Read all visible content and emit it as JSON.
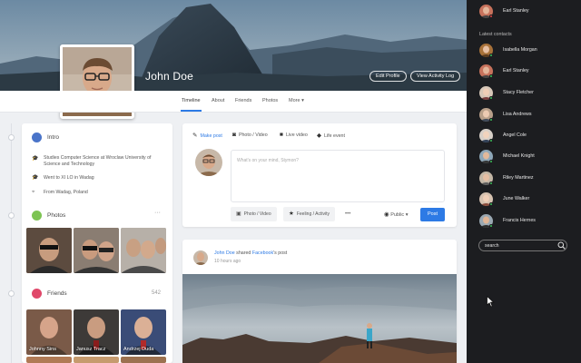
{
  "profile": {
    "name": "John Doe",
    "edit_profile": "Edit Profile",
    "view_activity": "View Activity Log"
  },
  "nav": {
    "tabs": [
      "Timeline",
      "About",
      "Friends",
      "Photos"
    ],
    "more": "More",
    "more_chevron": "▾"
  },
  "intro": {
    "title": "Intro",
    "items": [
      {
        "icon": "graduation-cap-icon",
        "text": "Studies Computer Science at Wroclaw University of Science and Technology"
      },
      {
        "icon": "graduation-cap-icon",
        "text": "Went to XI LO in Wadag"
      },
      {
        "icon": "location-pin-icon",
        "text": "From Wadag, Poland"
      }
    ]
  },
  "photos": {
    "title": "Photos",
    "more": "···"
  },
  "friends": {
    "title": "Friends",
    "count": "542",
    "list": [
      "Johnny Sins",
      "Janusz Tracz",
      "Andrzej Duda"
    ]
  },
  "composer": {
    "tabs": [
      {
        "icon": "pencil-icon",
        "label": "Make post"
      },
      {
        "icon": "camera-icon",
        "label": "Photo / Video"
      },
      {
        "icon": "video-camera-icon",
        "label": "Live video"
      },
      {
        "icon": "tag-icon",
        "label": "Life event"
      }
    ],
    "placeholder": "What's on your mind, Stymon?",
    "photo_video": "Photo / Video",
    "feeling": "Feeling / Activity",
    "more": "•••",
    "privacy": "Public",
    "privacy_chevron": "▾",
    "post": "Post"
  },
  "feed_post": {
    "author": "John Doe",
    "action": "shared",
    "page": "Facebook",
    "suffix": "'s post",
    "time": "10 hours ago"
  },
  "sidebar": {
    "current_user": "Earl Stanley",
    "contacts_title": "Latest contacts",
    "contacts": [
      "Isabella Morgan",
      "Earl Stanley",
      "Stacy Fletcher",
      "Lisa Andrews",
      "Angel Cole",
      "Michael Knight",
      "Riley Martinez",
      "June Walker",
      "Francis Hernes"
    ],
    "search_value": "search"
  },
  "colors": {
    "accent": "#2d7ae5",
    "intro_icon": "#4a74c9",
    "photos_icon": "#7dc453",
    "friends_icon": "#e0486a",
    "online": "#3ec25c",
    "sidebar_bg": "#1c1d20"
  }
}
